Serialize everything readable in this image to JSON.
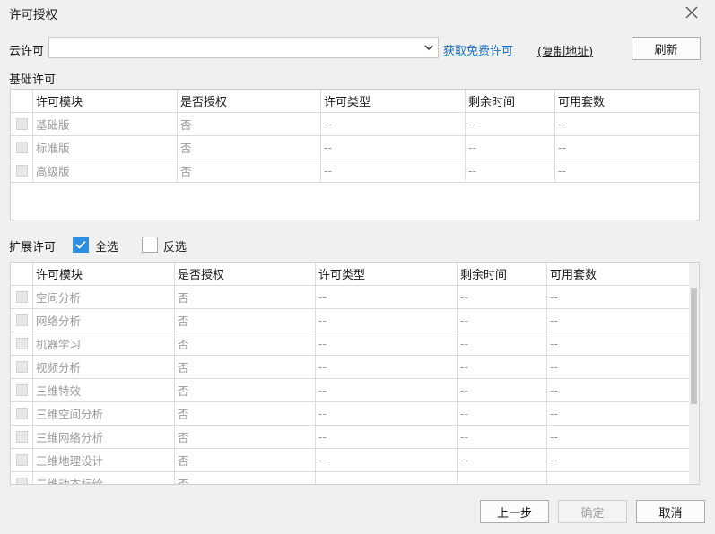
{
  "window": {
    "title": "许可授权"
  },
  "cloud": {
    "label": "云许可",
    "combo_value": "",
    "get_free_link": "获取免费许可",
    "copy_address_link": "(复制地址)",
    "refresh_button": "刷新"
  },
  "basic": {
    "section_label": "基础许可",
    "columns": [
      "许可模块",
      "是否授权",
      "许可类型",
      "剩余时间",
      "可用套数"
    ],
    "rows": [
      [
        "基础版",
        "否",
        "--",
        "--",
        "--"
      ],
      [
        "标准版",
        "否",
        "--",
        "--",
        "--"
      ],
      [
        "高级版",
        "否",
        "--",
        "--",
        "--"
      ]
    ]
  },
  "extended": {
    "section_label": "扩展许可",
    "select_all": {
      "label": "全选",
      "checked": true
    },
    "invert": {
      "label": "反选",
      "checked": false
    },
    "columns": [
      "许可模块",
      "是否授权",
      "许可类型",
      "剩余时间",
      "可用套数"
    ],
    "rows": [
      [
        "空间分析",
        "否",
        "--",
        "--",
        "--"
      ],
      [
        "网络分析",
        "否",
        "--",
        "--",
        "--"
      ],
      [
        "机器学习",
        "否",
        "--",
        "--",
        "--"
      ],
      [
        "视频分析",
        "否",
        "--",
        "--",
        "--"
      ],
      [
        "三维特效",
        "否",
        "--",
        "--",
        "--"
      ],
      [
        "三维空间分析",
        "否",
        "--",
        "--",
        "--"
      ],
      [
        "三维网络分析",
        "否",
        "--",
        "--",
        "--"
      ],
      [
        "三维地理设计",
        "否",
        "--",
        "--",
        "--"
      ],
      [
        "三维动态标绘",
        "否",
        "",
        "",
        ""
      ]
    ]
  },
  "footer": {
    "prev_button": "上一步",
    "ok_button": "确定",
    "cancel_button": "取消"
  },
  "colors": {
    "accent": "#2d8fe0",
    "link": "#1c6fc4"
  }
}
